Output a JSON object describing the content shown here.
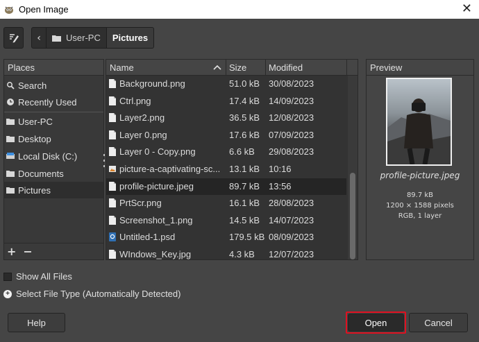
{
  "window": {
    "title": "Open Image"
  },
  "path_bar": {
    "segments": [
      "User-PC",
      "Pictures"
    ]
  },
  "places": {
    "header": "Places",
    "items": [
      {
        "label": "Search",
        "icon": "search-icon"
      },
      {
        "label": "Recently Used",
        "icon": "clock-icon"
      },
      {
        "label": "User-PC",
        "icon": "folder-icon"
      },
      {
        "label": "Desktop",
        "icon": "folder-icon"
      },
      {
        "label": "Local Disk (C:)",
        "icon": "drive-icon"
      },
      {
        "label": "Documents",
        "icon": "folder-icon"
      },
      {
        "label": "Pictures",
        "icon": "folder-icon",
        "selected": true
      }
    ],
    "add_label": "+",
    "remove_label": "−"
  },
  "file_list": {
    "columns": {
      "name": "Name",
      "size": "Size",
      "modified": "Modified"
    },
    "rows": [
      {
        "name": "Background.png",
        "size": "51.0 kB",
        "modified": "30/08/2023",
        "icon": "image-file-icon"
      },
      {
        "name": "Ctrl.png",
        "size": "17.4 kB",
        "modified": "14/09/2023",
        "icon": "image-file-icon"
      },
      {
        "name": "Layer2.png",
        "size": "36.5 kB",
        "modified": "12/08/2023",
        "icon": "image-file-icon"
      },
      {
        "name": "Layer 0.png",
        "size": "17.6 kB",
        "modified": "07/09/2023",
        "icon": "image-file-icon"
      },
      {
        "name": "Layer 0 - Copy.png",
        "size": "6.6 kB",
        "modified": "29/08/2023",
        "icon": "image-file-icon"
      },
      {
        "name": "picture-a-captivating-sc...",
        "size": "13.1 kB",
        "modified": "10:16",
        "icon": "picture-file-icon"
      },
      {
        "name": "profile-picture.jpeg",
        "size": "89.7 kB",
        "modified": "13:56",
        "icon": "image-file-icon",
        "selected": true
      },
      {
        "name": "PrtScr.png",
        "size": "16.1 kB",
        "modified": "28/08/2023",
        "icon": "image-file-icon"
      },
      {
        "name": "Screenshot_1.png",
        "size": "14.5 kB",
        "modified": "14/07/2023",
        "icon": "image-file-icon"
      },
      {
        "name": "Untitled-1.psd",
        "size": "179.5 kB",
        "modified": "08/09/2023",
        "icon": "psd-file-icon"
      },
      {
        "name": "WIndows_Key.jpg",
        "size": "4.3 kB",
        "modified": "12/07/2023",
        "icon": "image-file-icon"
      }
    ]
  },
  "preview": {
    "header": "Preview",
    "filename": "profile-picture.jpeg",
    "size": "89.7 kB",
    "dimensions": "1200 × 1588 pixels",
    "mode": "RGB, 1 layer"
  },
  "options": {
    "show_all_files": "Show All Files",
    "select_file_type": "Select File Type (Automatically Detected)"
  },
  "buttons": {
    "help": "Help",
    "open": "Open",
    "cancel": "Cancel"
  },
  "colors": {
    "background": "#454545",
    "highlight": "#e01020"
  }
}
